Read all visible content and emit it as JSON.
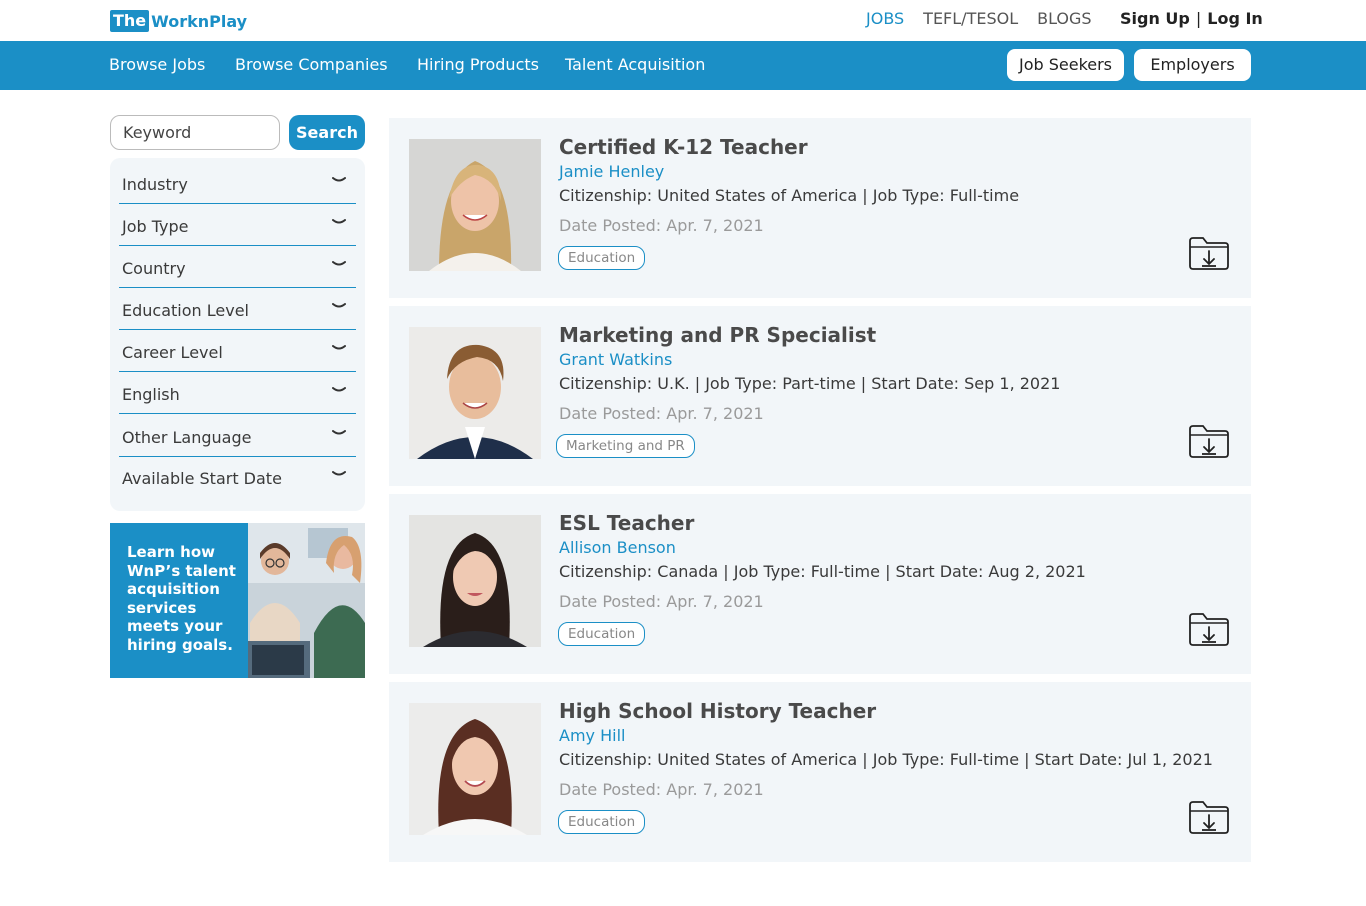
{
  "brand": {
    "logo_box": "The",
    "logo_rest": "WorknPlay"
  },
  "top_nav": {
    "jobs": "JOBS",
    "tefl": "TEFL/TESOL",
    "blogs": "BLOGS"
  },
  "auth": {
    "signup": "Sign Up",
    "sep": "|",
    "login": "Log In"
  },
  "main_nav": {
    "browse_jobs": "Browse Jobs",
    "browse_companies": "Browse Companies",
    "hiring_products": "Hiring Products",
    "talent_acquisition": "Talent Acquisition",
    "job_seekers": "Job Seekers",
    "employers": "Employers"
  },
  "search": {
    "placeholder": "Keyword",
    "button": "Search"
  },
  "filters": [
    {
      "label": "Industry"
    },
    {
      "label": "Job Type"
    },
    {
      "label": "Country"
    },
    {
      "label": "Education Level"
    },
    {
      "label": "Career Level"
    },
    {
      "label": "English"
    },
    {
      "label": "Other Language"
    },
    {
      "label": "Available Start Date"
    }
  ],
  "promo": {
    "lines": [
      "Learn how",
      "WnP’s talent",
      "acquisition",
      "services",
      "meets your",
      "hiring goals."
    ]
  },
  "candidates": [
    {
      "title": "Certified K-12 Teacher",
      "name": "Jamie Henley",
      "meta": "Citizenship: United States of America | Job Type: Full-time",
      "date": "Date Posted: Apr. 7, 2021",
      "tag": "Education"
    },
    {
      "title": "Marketing and PR Specialist",
      "name": "Grant Watkins",
      "meta": "Citizenship: U.K. | Job Type: Part-time | Start Date: Sep 1, 2021",
      "date": "Date Posted: Apr. 7, 2021",
      "tag": "Marketing and PR"
    },
    {
      "title": "ESL Teacher",
      "name": "Allison Benson",
      "meta": "Citizenship: Canada | Job Type: Full-time | Start Date: Aug 2, 2021",
      "date": "Date Posted: Apr. 7, 2021",
      "tag": "Education"
    },
    {
      "title": "High School History Teacher",
      "name": "Amy Hill",
      "meta": "Citizenship: United States of America | Job Type: Full-time | Start Date: Jul 1, 2021",
      "date": "Date Posted: Apr. 7, 2021",
      "tag": "Education"
    }
  ],
  "colors": {
    "brand_blue": "#1b8fc6",
    "card_bg": "#f2f6f9"
  }
}
